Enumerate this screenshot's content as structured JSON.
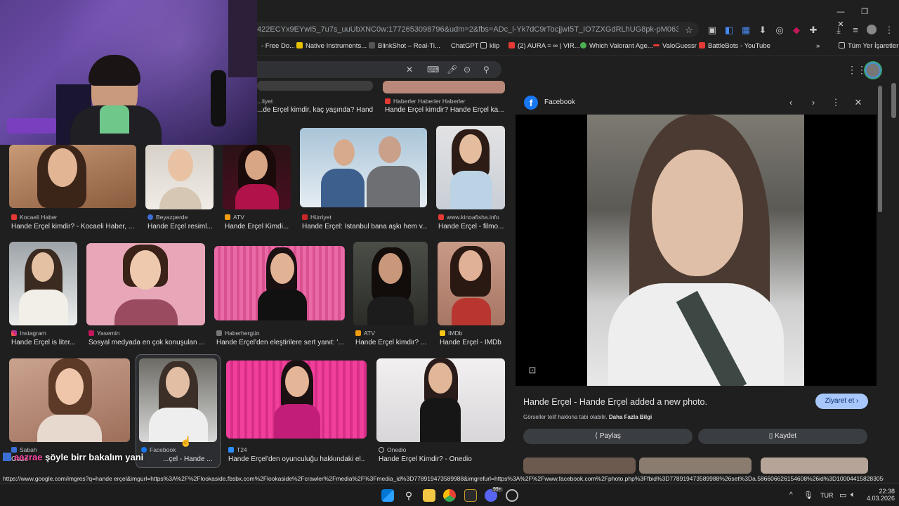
{
  "browser": {
    "url": "422ECYx9EYwI5_7u7s_uuUbXNC0w:1772653098796&udm=2&fbs=ADc_l-Yk7dC9rTocjjwI5T_IO7ZXGdRLhUG8pk-pM063RkPlLfa8y8TDcNYX0oihj...",
    "window_controls": [
      "—",
      "❐",
      "✕"
    ]
  },
  "bookmarks": [
    {
      "label": "- Free Do...",
      "color": "#ffffff"
    },
    {
      "label": "Native Instruments...",
      "color": "#e8c200"
    },
    {
      "label": "BlinkShot – Real-Ti...",
      "color": "#444444"
    },
    {
      "label": "ChatGPT",
      "color": "#1f1f1f"
    },
    {
      "label": "klip",
      "color": "#1f1f1f"
    },
    {
      "label": "(2) AURA = ∞ | VIR...",
      "color": "#e53935"
    },
    {
      "label": "Which Valorant Age...",
      "color": "#4caf50"
    },
    {
      "label": "ValoGuessr",
      "color": "#e53935"
    },
    {
      "label": "BattleBots - YouTube",
      "color": "#e53935"
    },
    {
      "label": "Tüm Yer İşaretleri",
      "color": "#1f1f1f"
    }
  ],
  "results": {
    "row0": [
      {
        "source": "...liyet",
        "title": "...de Erçel kimdir, kaç yaşında? Hand..."
      },
      {
        "source": "Haberler Haberler Haberler",
        "title": "Hande Erçel kimdir? Hande Erçel ka..."
      }
    ],
    "row1": [
      {
        "source": "Kocaeli Haber",
        "title": "Hande Erçel kimdir? - Kocaeli Haber, ..."
      },
      {
        "source": "Beyazperde",
        "title": "Hande Erçel resiml..."
      },
      {
        "source": "ATV",
        "title": "Hande Erçel Kimdi..."
      },
      {
        "source": "Hürriyet",
        "title": "Hande Erçel: İstanbul bana aşkı hem v..."
      },
      {
        "source": "www.kinoafisha.info",
        "title": "Hande Erçel - filmo..."
      }
    ],
    "row2": [
      {
        "source": "Instagram",
        "title": "Hande Erçel is liter..."
      },
      {
        "source": "Yasemin",
        "title": "Sosyal medyada en çok konuşulan ..."
      },
      {
        "source": "Haberhergün",
        "title": "Hande Erçel'den eleştirilere sert yanıt: '..."
      },
      {
        "source": "ATV",
        "title": "Hande Erçel kimdir? ..."
      },
      {
        "source": "IMDb",
        "title": "Hande Erçel - IMDb"
      }
    ],
    "row3": [
      {
        "source": "Sabah",
        "title": "Gazete..."
      },
      {
        "source": "Facebook",
        "title": "...çel - Hande ..."
      },
      {
        "source": "T24",
        "title": "Hande Erçel'den oyunculuğu hakkındaki el..."
      },
      {
        "source": "Onedio",
        "title": "Hande Erçel Kimdir? - Onedio"
      }
    ]
  },
  "panel": {
    "source": "Facebook",
    "title": "Hande Erçel - Hande Erçel added a new photo.",
    "visit": "Ziyaret et",
    "copyright": "Görseller telif hakkına tabi olabilir.",
    "more_info": "Daha Fazla Bilgi",
    "share": "Paylaş",
    "save": "Kaydet"
  },
  "caption": {
    "user": "aazrae",
    "text": "şöyle birr bakalım yani"
  },
  "status_url": "https://www.google.com/imgres?q=hande erçel&imgurl=https%3A%2F%2Flookaside.fbsbx.com%2Flookaside%2Fcrawler%2Fmedia%2F%3Fmedia_id%3D778919473589988&imgrefurl=https%3A%2F%2Fwww.facebook.com%2Fphoto.php%3Ffbid%3D778919473589988%26set%3Da.586606626154608%26id%3D100044158283050&docid=UooBbRKAOPZ...",
  "taskbar": {
    "lang": "TUR",
    "time": "22:38",
    "date": "4.03.2026",
    "badge": "99+"
  }
}
